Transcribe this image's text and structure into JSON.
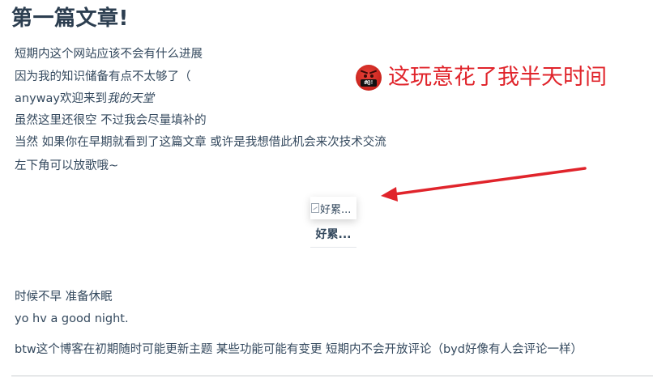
{
  "article": {
    "title": "第一篇文章!",
    "intro_lines": [
      "短期内这个网站应该不会有什么进展",
      "因为我的知识储备有点不太够了（",
      "anyway欢迎来到",
      "我的天堂",
      "虽然这里还很空 不过我会尽量填补的",
      "当然 如果你在早期就看到了这篇文章 或许是我想借此机会来次技术交流",
      "左下角可以放歌哦~"
    ],
    "annotation": {
      "icon": "angry-face-icon",
      "icon_symbols": "#@!",
      "text": "这玩意花了我半天时间",
      "color": "#e0242b"
    },
    "figure": {
      "alt_text": "好累...",
      "caption": "好累..."
    },
    "closing_lines": [
      "时候不早 准备休眠",
      "yo hv a good night."
    ],
    "footnote": "btw这个博客在初期随时可能更新主题 某些功能可能有变更 短期内不会开放评论（byd好像有人会评论一样）"
  },
  "colors": {
    "text": "#34495e",
    "heading": "#2c3e50",
    "annotation": "#e0242b",
    "divider": "#c9cdd1"
  }
}
